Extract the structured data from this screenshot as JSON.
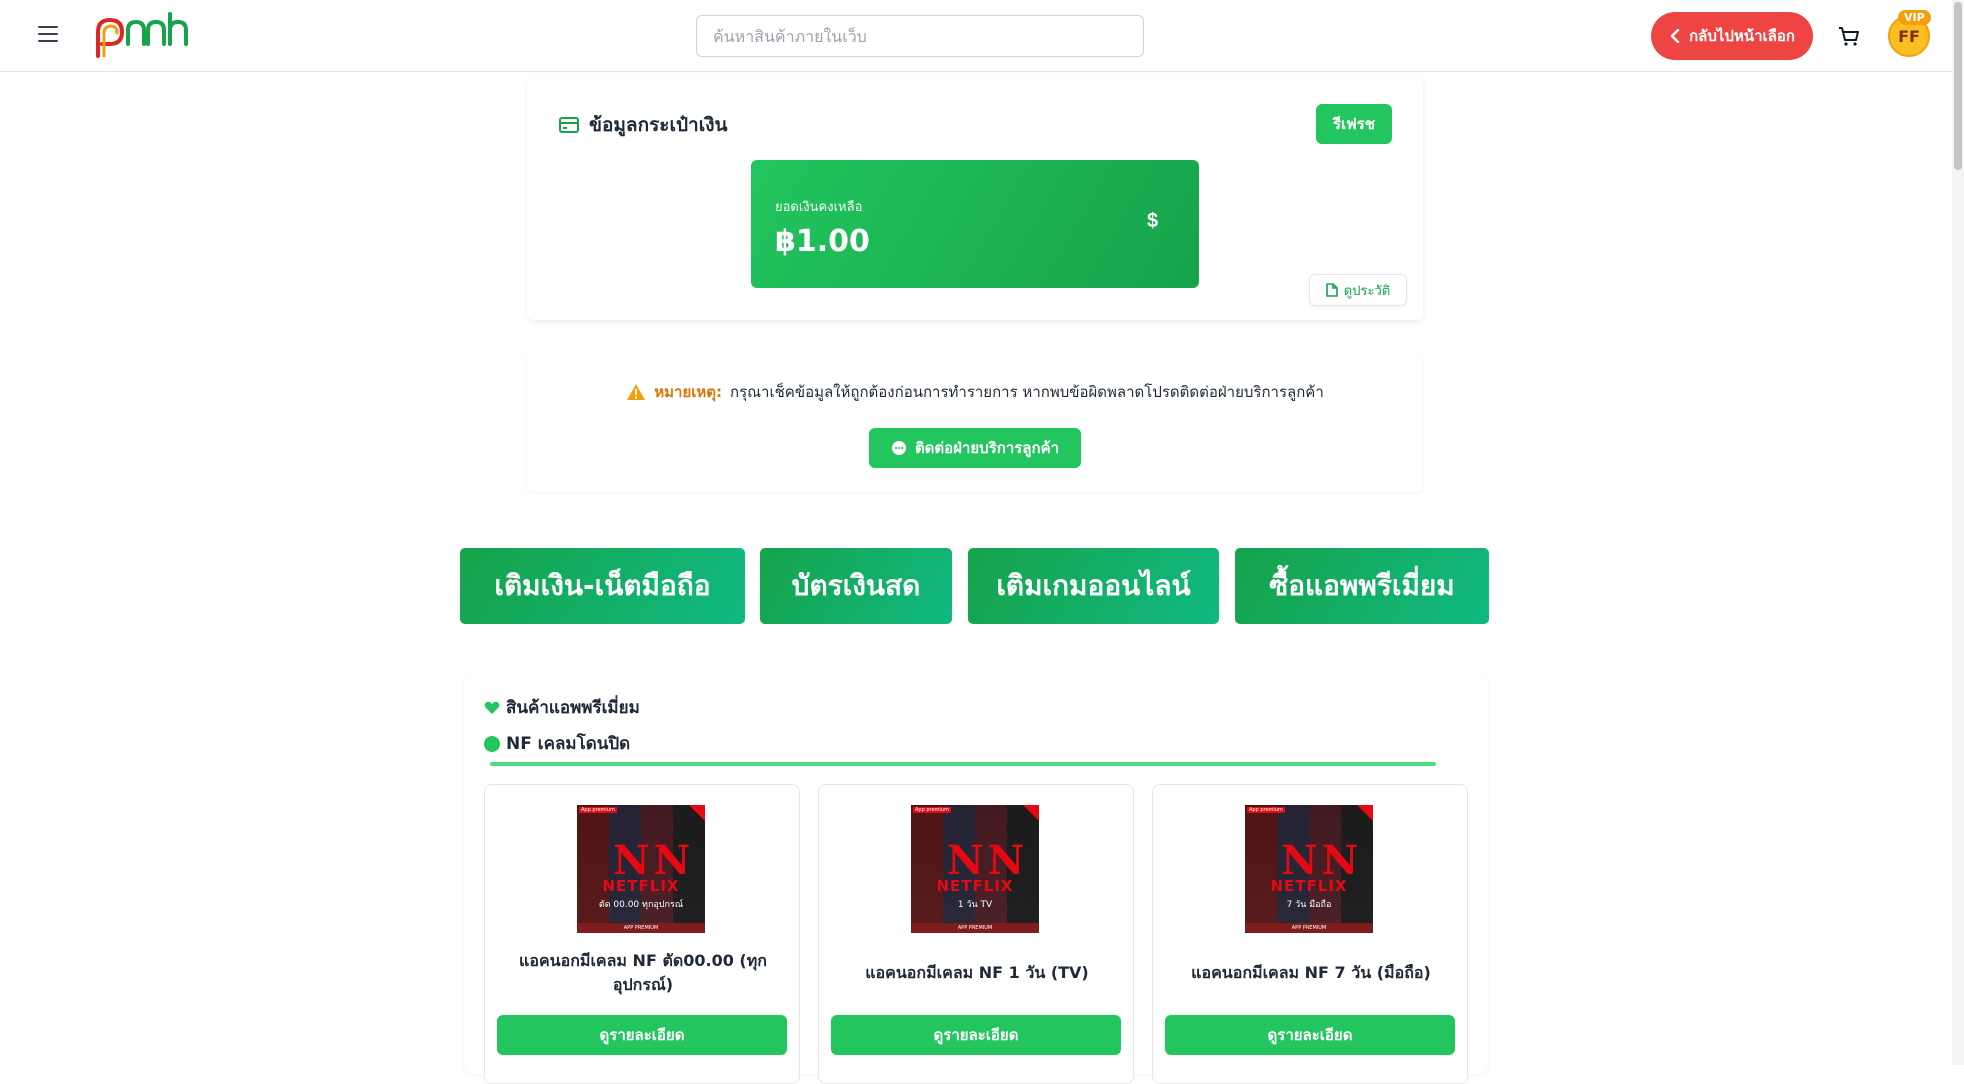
{
  "header": {
    "logo_text": "pnnh",
    "search_placeholder": "ค้นหาสินค้าภายในเว็บ",
    "back_label": "กลับไปหน้าเลือก",
    "avatar_initials": "FF",
    "vip_badge": "VIP"
  },
  "wallet": {
    "title": "ข้อมูลกระเป๋าเงิน",
    "refresh_label": "รีเฟรช",
    "balance_label": "ยอดเงินคงเหลือ",
    "balance_amount": "฿1.00",
    "currency_symbol": "$",
    "history_label": "ดูประวัติ"
  },
  "notice": {
    "label": "หมายเหตุ:",
    "text": "กรุณาเช็คข้อมูลให้ถูกต้องก่อนการทำรายการ หากพบข้อผิดพลาดโปรดติดต่อฝ่ายบริการลูกค้า",
    "contact_label": "ติดต่อฝ่ายบริการลูกค้า"
  },
  "categories": [
    "เติมเงิน-เน็ตมือถือ",
    "บัตรเงินสด",
    "เติมเกมออนไลน์",
    "ซื้อแอพพรีเมี่ยม"
  ],
  "products": {
    "heading": "สินค้าแอพพรีเมี่ยม",
    "subheading": "NF เคลมโดนปิด",
    "items": [
      {
        "name": "แอคนอกมีเคลม NF ตัด00.00 (ทุกอุปกรณ์)",
        "image_caption": "ตัด 00.00 ทุกอุปกรณ์",
        "button": "ดูรายละเอียด"
      },
      {
        "name": "แอคนอกมีเคลม NF 1 วัน (TV)",
        "image_caption": "1 วัน TV",
        "button": "ดูรายละเอียด"
      },
      {
        "name": "แอคนอกมีเคลม NF 7 วัน (มือถือ)",
        "image_caption": "7 วัน มือถือ",
        "button": "ดูรายละเอียด"
      }
    ],
    "image_logo_text": "NETFLIX",
    "image_tag": "App premium",
    "image_band": "APP PREMIUM"
  },
  "colors": {
    "accent": "#22c55e",
    "danger": "#ef4444",
    "warning": "#d97706",
    "vip": "#f59e0b"
  }
}
